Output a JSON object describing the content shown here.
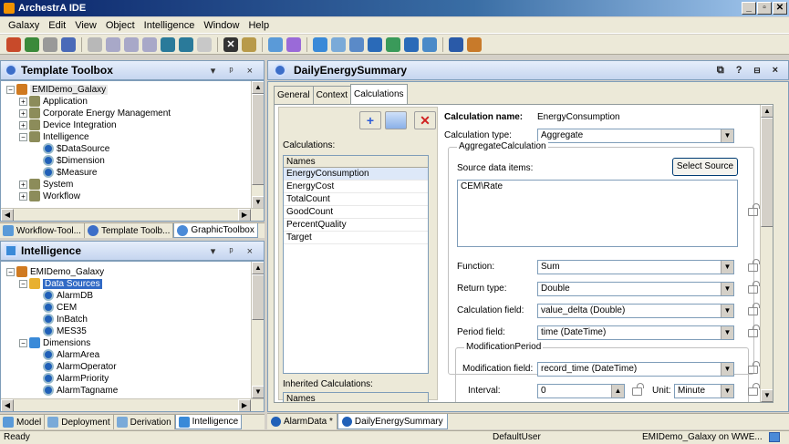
{
  "window": {
    "title": "ArchestrA IDE"
  },
  "menu": [
    "Galaxy",
    "Edit",
    "View",
    "Object",
    "Intelligence",
    "Window",
    "Help"
  ],
  "template_toolbox": {
    "title": "Template Toolbox",
    "root": "EMIDemo_Galaxy",
    "items": [
      "Application",
      "Corporate Energy Management",
      "Device Integration",
      "Intelligence",
      "$DataSource",
      "$Dimension",
      "$Measure",
      "System",
      "Workflow"
    ],
    "tabs": [
      "Workflow-Tool...",
      "Template Toolb...",
      "GraphicToolbox"
    ]
  },
  "intelligence": {
    "title": "Intelligence",
    "root": "EMIDemo_Galaxy",
    "items": [
      "Data Sources",
      "AlarmDB",
      "CEM",
      "InBatch",
      "MES35",
      "Dimensions",
      "AlarmArea",
      "AlarmOperator",
      "AlarmPriority",
      "AlarmTagname"
    ],
    "tabs": [
      "Model",
      "Deployment",
      "Derivation",
      "Intelligence"
    ]
  },
  "editor": {
    "title": "DailyEnergySummary",
    "tabs": [
      "General",
      "Context",
      "Calculations"
    ],
    "calculations_label": "Calculations:",
    "names_header": "Names",
    "calculations": [
      "EnergyConsumption",
      "EnergyCost",
      "TotalCount",
      "GoodCount",
      "PercentQuality",
      "Target"
    ],
    "inherited_label": "Inherited Calculations:",
    "inherited_header": "Names",
    "calc_name_label": "Calculation name:",
    "calc_name_value": "EnergyConsumption",
    "calc_type_label": "Calculation type:",
    "calc_type_value": "Aggregate",
    "aggregate_group": "AggregateCalculation",
    "source_items_label": "Source data items:",
    "select_source": "Select Source",
    "source_value": "CEM\\Rate",
    "function_label": "Function:",
    "function_value": "Sum",
    "return_label": "Return type:",
    "return_value": "Double",
    "calc_field_label": "Calculation field:",
    "calc_field_value": "value_delta (Double)",
    "period_label": "Period field:",
    "period_value": "time (DateTime)",
    "mod_period_group": "ModificationPeriod",
    "mod_field_label": "Modification field:",
    "mod_field_value": "record_time (DateTime)",
    "interval_label": "Interval:",
    "interval_value": "0",
    "unit_label": "Unit:",
    "unit_value": "Minute"
  },
  "doc_tabs": [
    "AlarmData *",
    "DailyEnergySummary"
  ],
  "status": {
    "left": "Ready",
    "user": "DefaultUser",
    "galaxy": "EMIDemo_Galaxy on WWE..."
  }
}
